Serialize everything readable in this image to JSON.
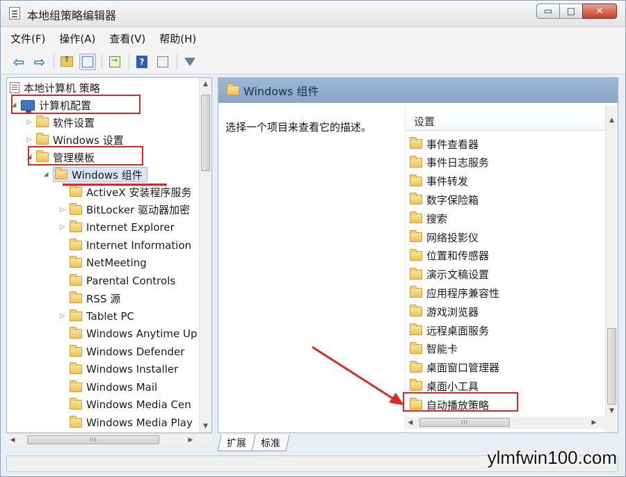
{
  "window": {
    "title": "本地组策略编辑器",
    "minimize_glyph": "▭",
    "maximize_glyph": "□",
    "close_glyph": "✕"
  },
  "menu": [
    "文件(F)",
    "操作(A)",
    "查看(V)",
    "帮助(H)"
  ],
  "toolbar": {
    "back_glyph": "⇦",
    "forward_glyph": "⇨",
    "help_glyph": "?"
  },
  "tree": {
    "root": "本地计算机 策略",
    "computer_config": "计算机配置",
    "software_settings": "软件设置",
    "windows_settings": "Windows 设置",
    "admin_templates": "管理模板",
    "windows_components": "Windows 组件",
    "children": [
      {
        "label": "ActiveX 安装程序服务",
        "expandable": false
      },
      {
        "label": "BitLocker 驱动器加密",
        "expandable": true
      },
      {
        "label": "Internet Explorer",
        "expandable": true
      },
      {
        "label": "Internet Information",
        "expandable": false
      },
      {
        "label": "NetMeeting",
        "expandable": false
      },
      {
        "label": "Parental Controls",
        "expandable": false
      },
      {
        "label": "RSS 源",
        "expandable": false
      },
      {
        "label": "Tablet PC",
        "expandable": true
      },
      {
        "label": "Windows Anytime Up",
        "expandable": false
      },
      {
        "label": "Windows Defender",
        "expandable": false
      },
      {
        "label": "Windows Installer",
        "expandable": false
      },
      {
        "label": "Windows Mail",
        "expandable": false
      },
      {
        "label": "Windows Media Cen",
        "expandable": false
      },
      {
        "label": "Windows Media Play",
        "expandable": false
      }
    ]
  },
  "right_pane": {
    "header": "Windows 组件",
    "description": "选择一个项目来查看它的描述。",
    "column_header": "设置",
    "items": [
      "事件查看器",
      "事件日志服务",
      "事件转发",
      "数字保险箱",
      "搜索",
      "网络投影仪",
      "位置和传感器",
      "演示文稿设置",
      "应用程序兼容性",
      "游戏浏览器",
      "远程桌面服务",
      "智能卡",
      "桌面窗口管理器",
      "桌面小工具",
      "自动播放策略"
    ]
  },
  "tabs": [
    "扩展",
    "标准"
  ],
  "scroll_glyph": "III",
  "watermark": "ylmfwin100.com",
  "colors": {
    "highlight_red": "#e0242a",
    "header_blue": "#8aa5c9",
    "folder_yellow": "#eec456"
  }
}
